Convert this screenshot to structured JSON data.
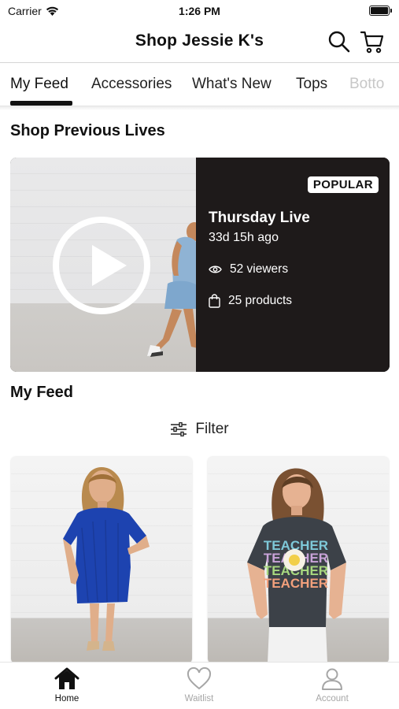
{
  "status_bar": {
    "carrier": "Carrier",
    "time": "1:26 PM"
  },
  "header": {
    "title": "Shop Jessie K's"
  },
  "tabs": [
    {
      "label": "My Feed",
      "active": true
    },
    {
      "label": "Accessories"
    },
    {
      "label": "What's New"
    },
    {
      "label": "Tops"
    },
    {
      "label": "Botto"
    }
  ],
  "previous_lives": {
    "heading": "Shop Previous Lives",
    "card": {
      "badge": "POPULAR",
      "title": "Thursday Live",
      "ago": "33d 15h ago",
      "viewers": "52 viewers",
      "products": "25 products"
    }
  },
  "feed": {
    "heading": "My Feed",
    "filter_label": "Filter",
    "products": [
      {
        "image": "woman-blue-dress-photo",
        "garment_color": "#1d43b0"
      },
      {
        "image": "woman-teacher-tshirt-photo",
        "garment_color": "#3c4148",
        "shirt_text": "TEACHER"
      }
    ]
  },
  "bottom_nav": [
    {
      "label": "Home",
      "icon": "home-icon",
      "active": true
    },
    {
      "label": "Waitlist",
      "icon": "heart-icon"
    },
    {
      "label": "Account",
      "icon": "person-icon"
    }
  ],
  "colors": {
    "card_dark": "#1e1a1a",
    "inactive_nav": "#a6a6a6"
  }
}
